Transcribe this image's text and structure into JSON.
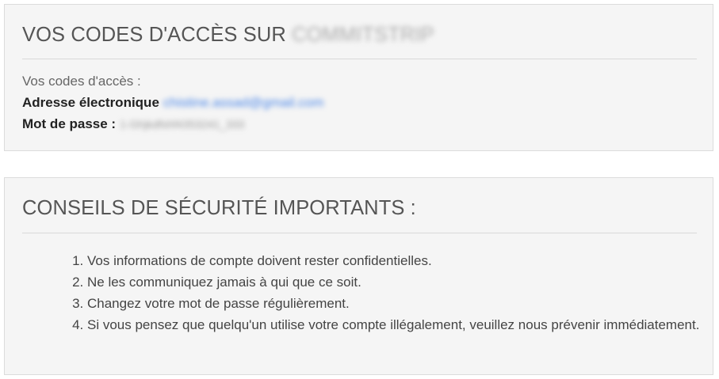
{
  "credentials": {
    "title": "VOS CODES D'ACCÈS SUR",
    "site_name_redacted": "COMMITSTRIP",
    "intro": "Vos codes d'accès :",
    "email_label": "Adresse électronique",
    "email_value_redacted": "chistine.assad@gmail.com",
    "password_label": "Mot de passe :",
    "password_value_redacted": "1-Ghjkdfshf4353241_333"
  },
  "security": {
    "title": "CONSEILS DE SÉCURITÉ IMPORTANTS :",
    "tips": [
      "Vos informations de compte doivent rester confidentielles.",
      "Ne les communiquez jamais à qui que ce soit.",
      "Changez votre mot de passe régulièrement.",
      "Si vous pensez que quelqu'un utilise votre compte illégalement, veuillez nous prévenir immédiatement."
    ]
  },
  "colors": {
    "panel_background": "#f5f5f5",
    "panel_border": "#dcdcdc",
    "title_text": "#555555",
    "link": "#4a86e8"
  }
}
